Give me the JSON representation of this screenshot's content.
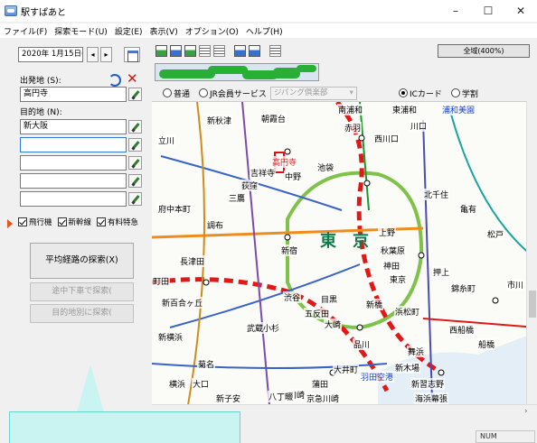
{
  "window": {
    "title": "駅すぱあと",
    "controls": {
      "minimize": "–",
      "maximize": "☐",
      "close": "✕"
    }
  },
  "menu": [
    "ファイル(F)",
    "探索モード(U)",
    "設定(E)",
    "表示(V)",
    "オプション(O)",
    "ヘルプ(H)"
  ],
  "left": {
    "date": "2020年 1月15日(水)",
    "prev": "◂",
    "next": "▸",
    "from_label": "出発地 (S):",
    "from_value": "高円寺",
    "to_label": "目的地 (N):",
    "to_values": [
      "新大阪",
      "",
      "",
      "",
      ""
    ],
    "checks": [
      {
        "label": "飛行機",
        "checked": true
      },
      {
        "label": "新幹線",
        "checked": true
      },
      {
        "label": "有料特急",
        "checked": true
      }
    ],
    "search_button": "平均経路の探索(X)",
    "via_button": "途中下車で探索(",
    "dest_button": "目的地別に探索("
  },
  "toolbar": {
    "region_button": "全域(400%)"
  },
  "options": {
    "normal": "普通",
    "jr_member": "JR会員サービス",
    "club_select": "ジパング倶楽部",
    "ic_card": "ICカード",
    "student": "学割"
  },
  "map": {
    "center_kanji": [
      "東",
      "京"
    ],
    "places": [
      "南浦和",
      "東浦和",
      "浦和美園",
      "朝霞台",
      "新秋津",
      "赤羽",
      "川口",
      "西川口",
      "吉祥寺",
      "中野",
      "高円寺",
      "池袋",
      "上野",
      "秋葉原",
      "新宿",
      "渋谷",
      "品川",
      "大崎",
      "五反田",
      "目黒",
      "東京",
      "神田",
      "押上",
      "錦糸町",
      "新橋",
      "浜松町",
      "大井町",
      "蒲田",
      "川崎",
      "横浜",
      "武蔵小杉",
      "府中本町",
      "立川",
      "調布",
      "三鷹",
      "荻窪",
      "北千住",
      "亀有",
      "松戸",
      "市川",
      "西船橋",
      "船橋",
      "新習志野",
      "海浜幕張",
      "舞浜",
      "新木場",
      "羽田空港",
      "京急川崎",
      "八丁畷",
      "新子安",
      "大口",
      "菊名",
      "新横浜",
      "新百合ヶ丘",
      "町田",
      "長津田"
    ]
  },
  "status": {
    "numlock": "NUM"
  }
}
